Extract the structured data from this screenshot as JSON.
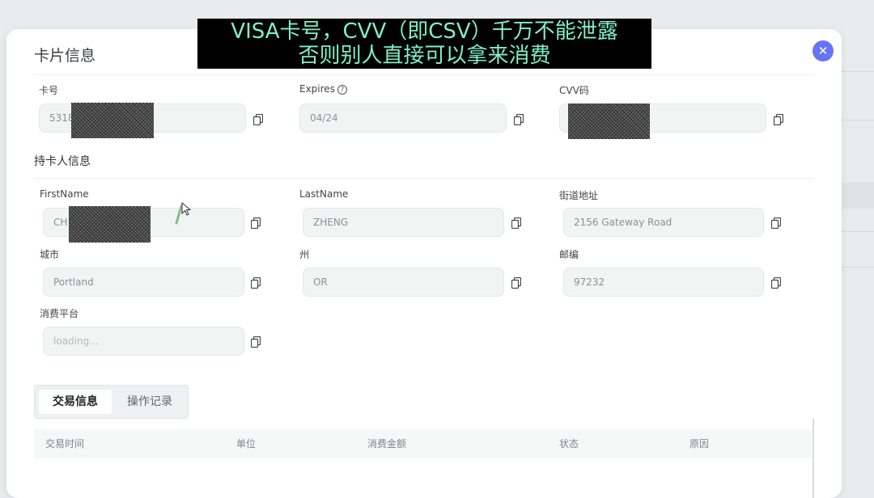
{
  "overlay_caption": {
    "line1": "VISA卡号，CVV（即CSV）千万不能泄露",
    "line2": "否则别人直接可以拿来消费"
  },
  "modal": {
    "title": "卡片信息",
    "close_icon": "close-icon",
    "card_section": {
      "card_number": {
        "label": "卡号",
        "value": "5318"
      },
      "expires": {
        "label": "Expires",
        "value": "04/24",
        "help_icon": "question-circle-icon"
      },
      "cvv": {
        "label": "CVV码",
        "value": ""
      }
    },
    "holder_section": {
      "heading": "持卡人信息",
      "first_name": {
        "label": "FirstName",
        "value": "CH"
      },
      "last_name": {
        "label": "LastName",
        "value": "ZHENG"
      },
      "street": {
        "label": "街道地址",
        "value": "2156  Gateway Road"
      },
      "city": {
        "label": "城市",
        "value": "Portland"
      },
      "state": {
        "label": "州",
        "value": "OR"
      },
      "zip": {
        "label": "邮编",
        "value": "97232"
      },
      "platform": {
        "label": "消费平台",
        "placeholder": "loading..."
      }
    },
    "tabs": [
      {
        "label": "交易信息",
        "active": true
      },
      {
        "label": "操作记录",
        "active": false
      }
    ],
    "table": {
      "columns": [
        "交易时间",
        "单位",
        "消费金额",
        "状态",
        "原因"
      ]
    }
  },
  "colors": {
    "accent": "#6674f5",
    "caption_text": "#7ff0c8",
    "input_bg": "#f2f4f4"
  }
}
